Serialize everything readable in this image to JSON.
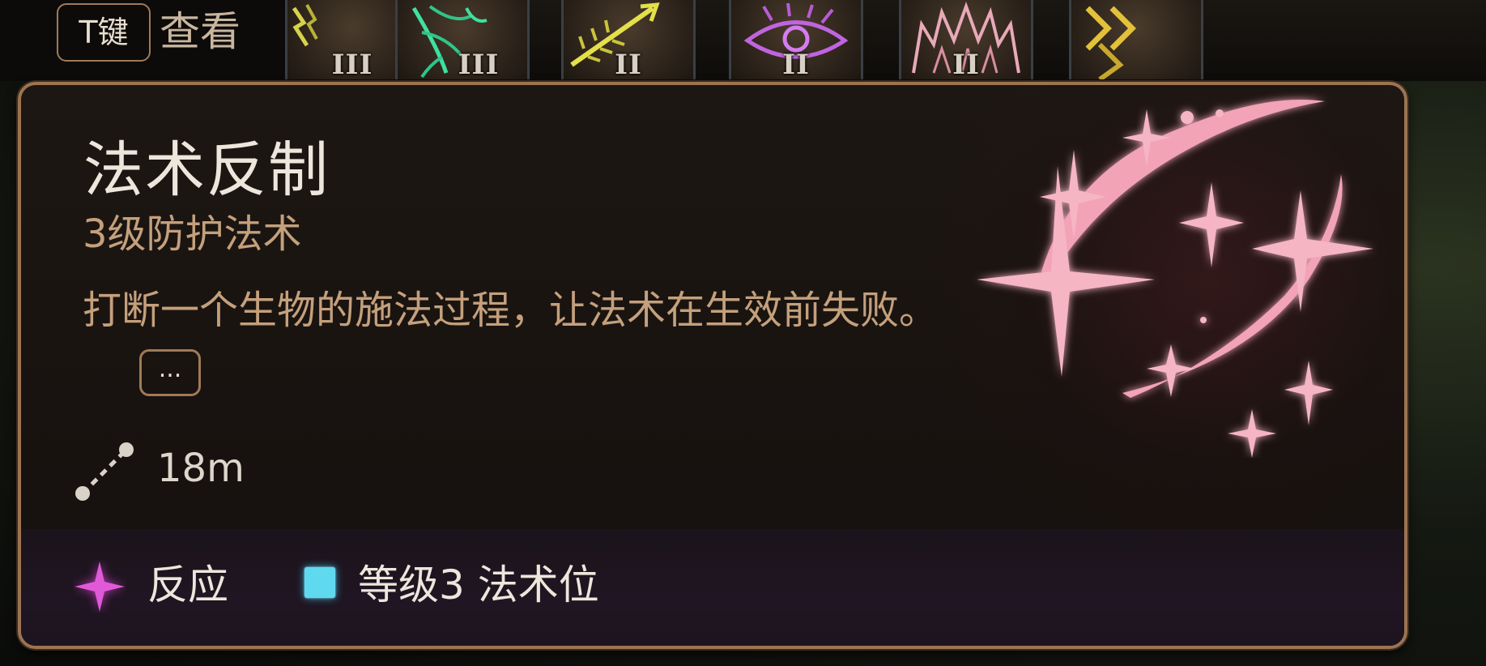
{
  "hotbar": {
    "key_hint": {
      "key": "T键",
      "label": "查看"
    },
    "slots": [
      {
        "icon": "lightning-spell-icon",
        "level": "III"
      },
      {
        "icon": "green-thorn-spell-icon",
        "level": "III"
      },
      {
        "icon": "yellow-arrow-spell-icon",
        "level": "II"
      },
      {
        "icon": "purple-eye-spell-icon",
        "level": "II"
      },
      {
        "icon": "crown-burst-spell-icon",
        "level": "II"
      },
      {
        "icon": "yellow-chevron-spell-icon",
        "level": ""
      }
    ]
  },
  "tooltip": {
    "title": "法术反制",
    "subtitle": "3级防护法术",
    "description": "打断一个生物的施法过程，让法术在生效前失败。",
    "more_label": "...",
    "range": "18m",
    "art_icon": "counterspell-sparkle-art",
    "footer": {
      "action_type": "反应",
      "resource": "等级3 法术位"
    }
  },
  "colors": {
    "frame_border": "#9c7451",
    "title": "#ece6dc",
    "subtitle": "#c4a07c",
    "reaction": "#e05ad8",
    "spell_slot": "#5fd9ee"
  }
}
